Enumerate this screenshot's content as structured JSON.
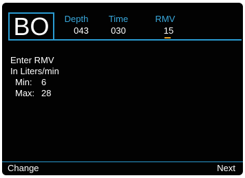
{
  "header": {
    "mode": "BO",
    "fields": [
      {
        "label": "Depth",
        "value": "043"
      },
      {
        "label": "Time",
        "value": "030"
      },
      {
        "label": "RMV",
        "value": "15"
      }
    ]
  },
  "prompt": {
    "line1": "Enter RMV",
    "line2": "In Liters/min",
    "min_label": "Min:",
    "min_value": "6",
    "max_label": "Max:",
    "max_value": "28"
  },
  "footer": {
    "left_key": "Change",
    "right_key": "Next"
  },
  "colors": {
    "background": "#020202",
    "accent": "#2a9bd2",
    "label": "#39a8dc",
    "text": "#ffffff",
    "cursor": "#e3a22c"
  }
}
